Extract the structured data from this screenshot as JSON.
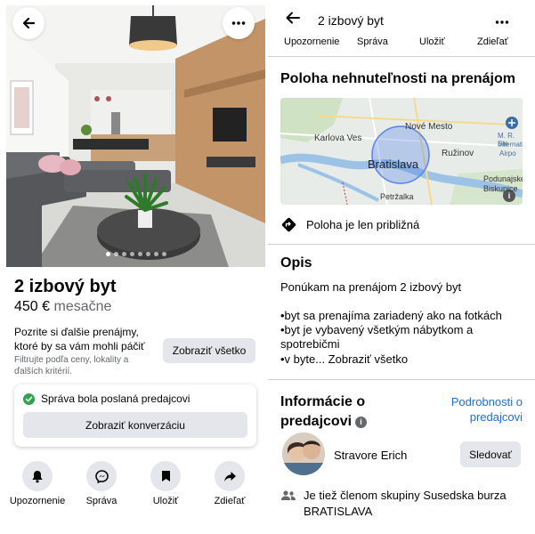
{
  "listing": {
    "title": "2 izbový byt",
    "price": "450 €",
    "price_period": "mesačne",
    "photo_count": 8,
    "photo_index": 0
  },
  "suggestions": {
    "text": "Pozrite si ďalšie prenájmy, ktoré by sa vám mohli páčiť",
    "subtext": "Filtrujte podľa ceny, lokality a ďalších kritérií.",
    "button": "Zobraziť všetko"
  },
  "message_sent": {
    "status": "Správa bola poslaná predajcovi",
    "button": "Zobraziť konverzáciu"
  },
  "actions": [
    {
      "label": "Upozornenie",
      "icon": "bell-icon"
    },
    {
      "label": "Správa",
      "icon": "messenger-icon"
    },
    {
      "label": "Uložiť",
      "icon": "bookmark-icon"
    },
    {
      "label": "Zdieľať",
      "icon": "share-icon"
    }
  ],
  "right_header": {
    "title": "2 izbový byt",
    "tabs": [
      "Upozornenie",
      "Správa",
      "Uložiť",
      "Zdieľať"
    ]
  },
  "location": {
    "heading": "Poloha nehnuteľnosti na prenájom",
    "map_labels": {
      "karlova_ves": "Karlova Ves",
      "nove_mesto": "Nové Mesto",
      "bratislava": "Bratislava",
      "ruzinov": "Ružinov",
      "podunajske": "Podunajské",
      "biskupice": "Biskupice",
      "petrzalka": "Petržalka",
      "airport_line1": "M. R. Ste",
      "airport_line2": "Internati",
      "airport_line3": "Airpo"
    },
    "approx_note": "Poloha je len približná"
  },
  "description": {
    "heading": "Opis",
    "intro": "Ponúkam na prenájom 2 izbový byt",
    "line1": "•byt sa prenajíma zariadený ako na fotkách",
    "line2": "•byt je vybavený všetkým nábytkom a",
    "line3": "spotrebičmi",
    "line4": "•v byte... Zobraziť všetko"
  },
  "seller": {
    "heading": "Informácie o predajcovi",
    "details_link": "Podrobnosti o predajcovi",
    "name": "Stravore Erich",
    "follow_button": "Sledovať",
    "group_note": "Je tiež členom skupiny Susedska burza BRATISLAVA"
  },
  "colors": {
    "accent_blue": "#216fdb",
    "success_green": "#31a24c",
    "button_gray": "#e4e6eb",
    "secondary_text": "#65676b"
  }
}
